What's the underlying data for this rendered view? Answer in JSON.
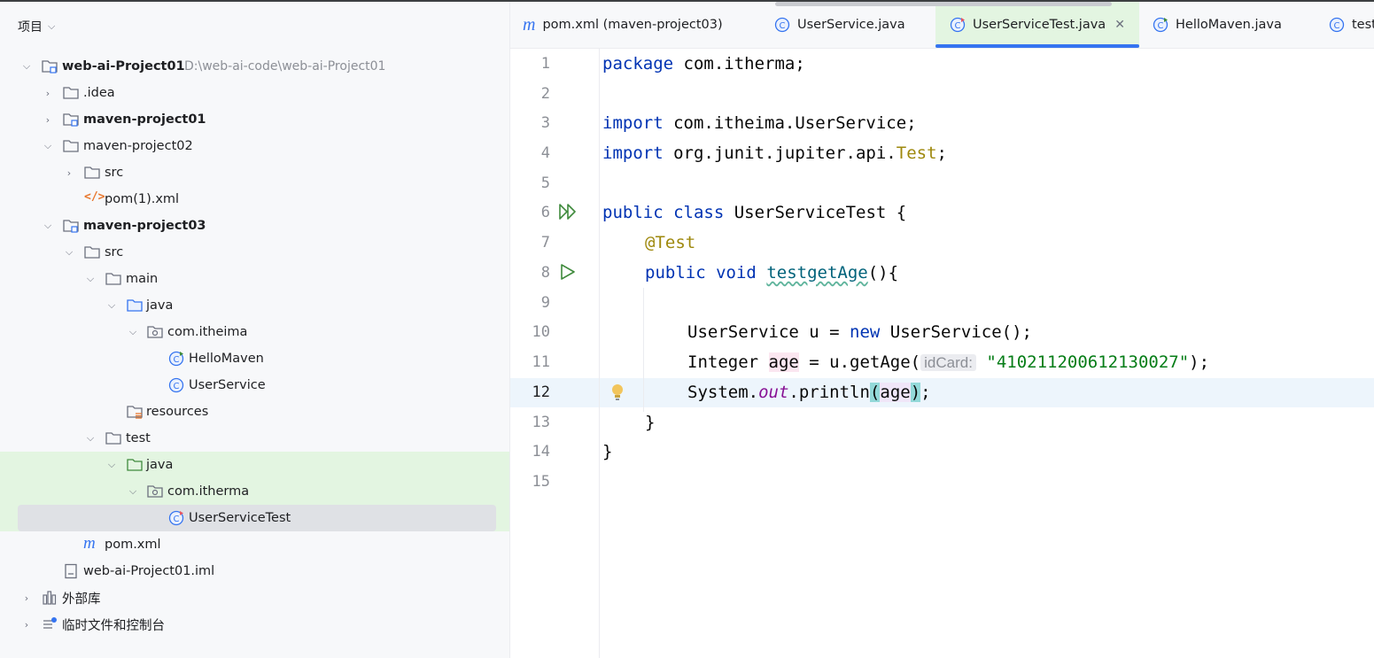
{
  "project_panel": {
    "title": "项目",
    "items": [
      {
        "label": "web-ai-Project01",
        "path": "D:\\web-ai-code\\web-ai-Project01"
      },
      {
        "label": ".idea"
      },
      {
        "label": "maven-project01"
      },
      {
        "label": "maven-project02"
      },
      {
        "label": "src"
      },
      {
        "label": "pom(1).xml"
      },
      {
        "label": "maven-project03"
      },
      {
        "label": "src"
      },
      {
        "label": "main"
      },
      {
        "label": "java"
      },
      {
        "label": "com.itheima"
      },
      {
        "label": "HelloMaven"
      },
      {
        "label": "UserService"
      },
      {
        "label": "resources"
      },
      {
        "label": "test"
      },
      {
        "label": "java"
      },
      {
        "label": "com.itherma"
      },
      {
        "label": "UserServiceTest"
      },
      {
        "label": "pom.xml"
      },
      {
        "label": "web-ai-Project01.iml"
      },
      {
        "label": "外部库"
      },
      {
        "label": "临时文件和控制台"
      }
    ]
  },
  "tabs": [
    {
      "label": "pom.xml (maven-project03)"
    },
    {
      "label": "UserService.java"
    },
    {
      "label": "UserServiceTest.java",
      "active": true
    },
    {
      "label": "HelloMaven.java"
    },
    {
      "label": "test"
    }
  ],
  "editor": {
    "line_numbers": [
      "1",
      "2",
      "3",
      "4",
      "5",
      "6",
      "7",
      "8",
      "9",
      "10",
      "11",
      "12",
      "13",
      "14",
      "15"
    ],
    "current_line": "12",
    "code": {
      "l1_kw": "package",
      "l1_rest": " com.itherma;",
      "l3_kw": "import",
      "l3_rest": " com.itheima.UserService;",
      "l4_kw": "import",
      "l4_rest": " org.junit.jupiter.api.",
      "l4_cls": "Test",
      "l4_end": ";",
      "l6_kw1": "public",
      "l6_kw2": "class",
      "l6_rest": " UserServiceTest {",
      "l7_ann": "@Test",
      "l8_kw1": "public",
      "l8_kw2": "void",
      "l8_meth": "testgetAge",
      "l8_rest": "(){",
      "l10_a": "UserService u = ",
      "l10_kw": "new",
      "l10_b": " UserService();",
      "l11_a": "Integer ",
      "l11_var": "age",
      "l11_b": " = u.getAge(",
      "l11_hint": "idCard:",
      "l11_str": "\"410211200612130027\"",
      "l11_end": ");",
      "l12_a": "System.",
      "l12_out": "out",
      "l12_b": ".println",
      "l12_open": "(",
      "l12_var": "age",
      "l12_close": ")",
      "l12_end": ";",
      "l13": "}",
      "l14": "}"
    }
  },
  "colors": {
    "keyword": "#0033b3",
    "string": "#067d17",
    "annotation": "#9e880d",
    "accent": "#3574f0",
    "test_bg": "#e3f5e1"
  }
}
